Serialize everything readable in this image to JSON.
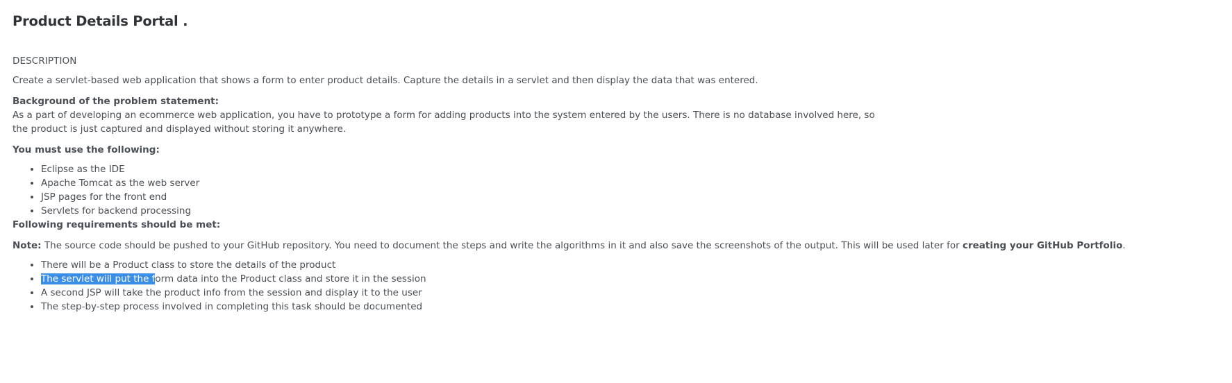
{
  "page": {
    "title": "Product Details Portal ."
  },
  "description": {
    "heading": "DESCRIPTION",
    "intro": "Create a servlet-based web application that shows a form to enter product details. Capture the details in a servlet and then display the data that was entered."
  },
  "background": {
    "heading": "Background of the problem statement:",
    "line1": "As a part of developing an ecommerce web application, you have to prototype a form for adding products into the system entered by the users. There is no database involved here, so",
    "line2": "the product is just captured and displayed without storing it anywhere."
  },
  "must_use": {
    "heading": "You must use the following:",
    "items": [
      "Eclipse as the IDE",
      "Apache Tomcat as the web server",
      "JSP pages for the front end",
      "Servlets for backend processing"
    ]
  },
  "requirements": {
    "heading": "Following requirements should be met:"
  },
  "note": {
    "label": "Note:",
    "text": " The source code should be pushed to your GitHub repository. You need to document the steps and write the algorithms in it and also save the screenshots of the output. This will be used later for ",
    "emphasis": "creating your GitHub Portfolio",
    "end": "."
  },
  "requirement_items": {
    "item1": "There will be a Product class to store the details of the product",
    "item2_selected": "The servlet will put the f",
    "item2_rest": "orm data into the Product class and store it in the session",
    "item3": "A second JSP will take the product info from the session and display it to the user",
    "item4": "The step-by-step process involved in completing this task should be documented"
  },
  "colors": {
    "text": "#4a4f55",
    "title": "#2f3338",
    "selection": "#3a8ee6"
  }
}
